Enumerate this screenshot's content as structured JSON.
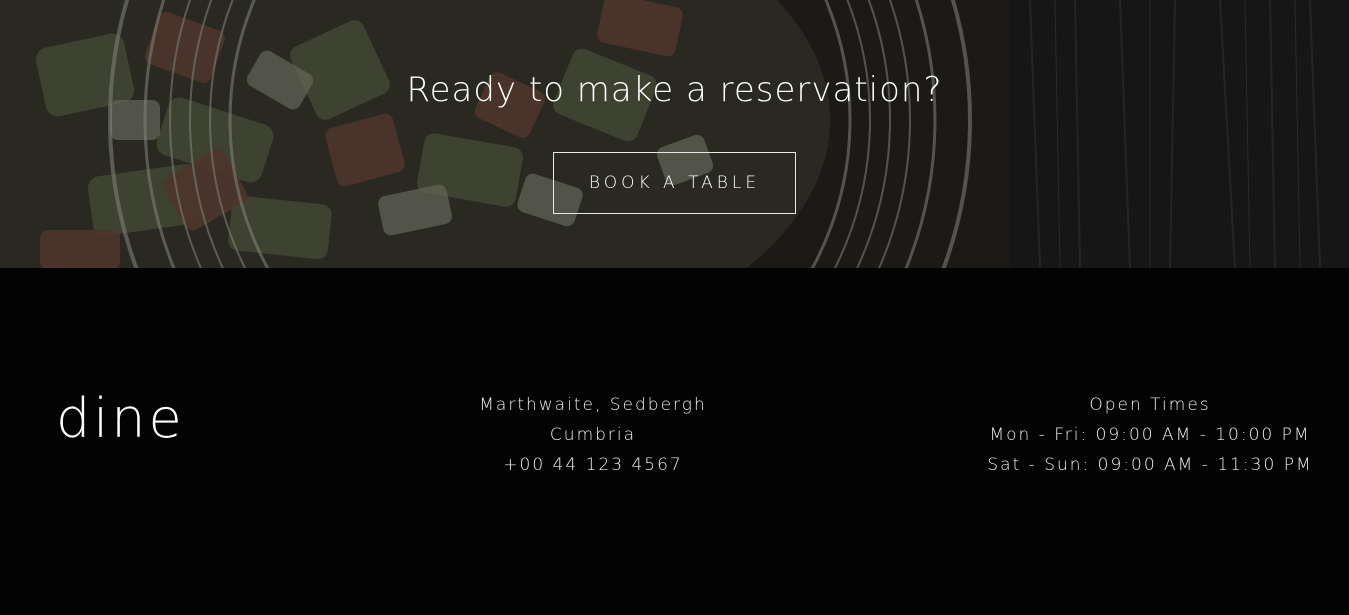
{
  "hero": {
    "heading": "Ready to make a reservation?",
    "button_label": "BOOK A TABLE"
  },
  "footer": {
    "logo": "dine",
    "address": {
      "line1": "Marthwaite, Sedbergh",
      "line2": "Cumbria",
      "phone": "+00 44 123 4567"
    },
    "hours": {
      "title": "Open Times",
      "weekday": "Mon - Fri: 09:00 AM - 10:00 PM",
      "weekend": "Sat - Sun: 09:00 AM - 11:30 PM"
    }
  },
  "colors": {
    "background": "#030303",
    "text": "#ffffff",
    "button_border": "#e8e8e8"
  }
}
